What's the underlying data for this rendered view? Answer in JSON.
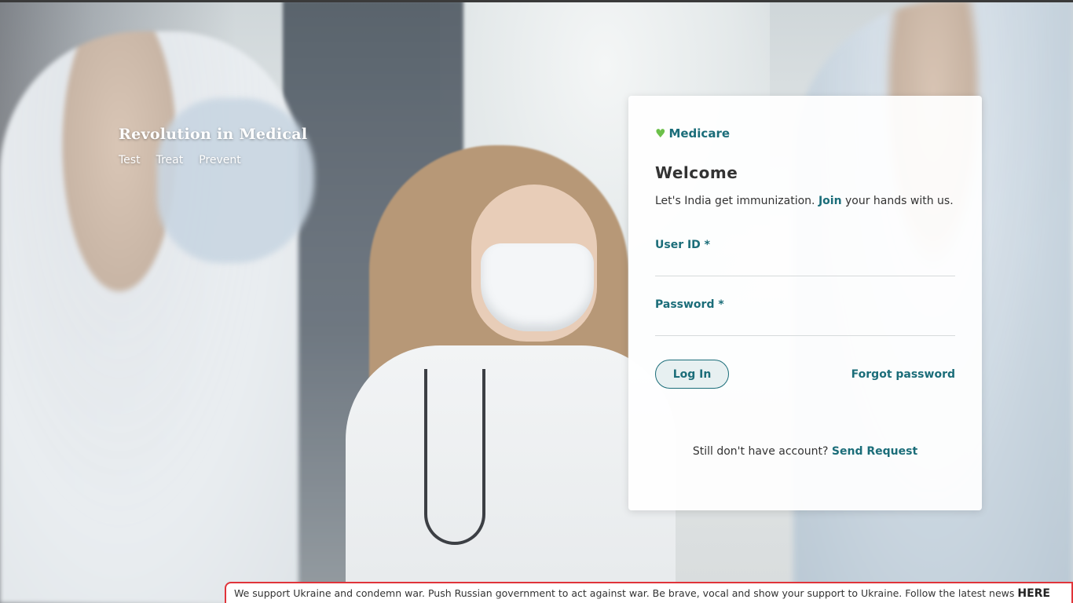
{
  "hero": {
    "title": "Revolution in Medical",
    "tags": [
      "Test",
      "Treat",
      "Prevent"
    ]
  },
  "login": {
    "brand_icon": "heart-icon",
    "brand_icon_color": "#6cc04a",
    "brand": "Medicare",
    "welcome": "Welcome",
    "tagline_before": "Let's India get immunization. ",
    "tagline_link": "Join",
    "tagline_after": " your hands with us.",
    "user_id_label": "User ID *",
    "user_id_value": "",
    "password_label": "Password *",
    "password_value": "",
    "login_button": "Log In",
    "forgot_link": "Forgot password",
    "request_text": "Still don't have account? ",
    "request_link": "Send Request"
  },
  "banner": {
    "text": "We support Ukraine and condemn war. Push Russian government to act against war. Be brave, vocal and show your support to Ukraine. Follow the latest news ",
    "link": "HERE"
  },
  "colors": {
    "accent": "#1b6d79",
    "brand_heart": "#6cc04a",
    "banner_border": "#e0343a"
  }
}
